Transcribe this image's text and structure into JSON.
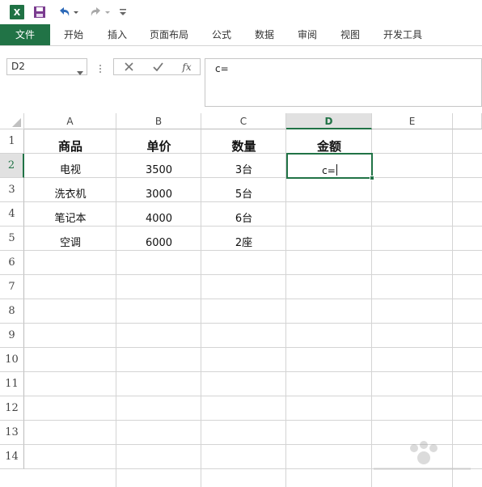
{
  "quick_access": {
    "app_icon_letter": "X",
    "colors": {
      "excel_green": "#217346",
      "selected_header": "#e1e1e1"
    }
  },
  "ribbon": {
    "tabs": [
      "文件",
      "开始",
      "插入",
      "页面布局",
      "公式",
      "数据",
      "审阅",
      "视图",
      "开发工具"
    ],
    "active_tab": "文件"
  },
  "formula_bar": {
    "name_box": "D2",
    "cancel_icon": "close-icon",
    "enter_icon": "check-icon",
    "fx_label": "fx",
    "formula": "c="
  },
  "sheet": {
    "columns": [
      "A",
      "B",
      "C",
      "D",
      "E"
    ],
    "selected_column": "D",
    "rows": [
      "1",
      "2",
      "3",
      "4",
      "5",
      "6",
      "7",
      "8",
      "9",
      "10",
      "11",
      "12",
      "13",
      "14"
    ],
    "selected_row": "2",
    "header_row": [
      "商品",
      "单价",
      "数量",
      "金额"
    ],
    "data": [
      [
        "电视",
        "3500",
        "3台"
      ],
      [
        "洗衣机",
        "3000",
        "5台"
      ],
      [
        "笔记本",
        "4000",
        "6台"
      ],
      [
        "空调",
        "6000",
        "2座"
      ]
    ],
    "active_cell_content": "c="
  }
}
